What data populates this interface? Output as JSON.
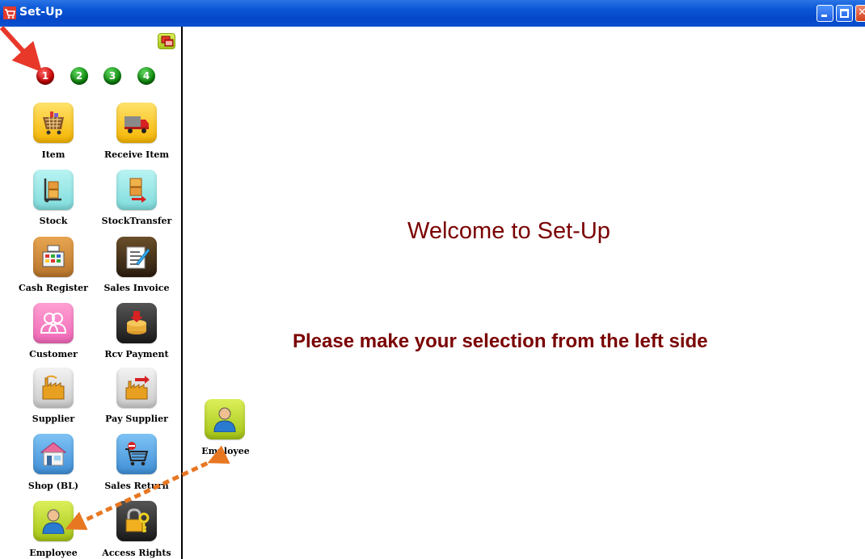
{
  "window": {
    "title": "Set-Up",
    "icon": "cart-icon",
    "controls": [
      "minimize-icon",
      "maximize-icon",
      "close-icon"
    ]
  },
  "sidebar": {
    "toggle_icon": "windows-icon",
    "pages": [
      {
        "label": "1",
        "state": "active",
        "color": "#c00000"
      },
      {
        "label": "2",
        "state": "inactive",
        "color": "#108a10"
      },
      {
        "label": "3",
        "state": "inactive",
        "color": "#108a10"
      },
      {
        "label": "4",
        "state": "inactive",
        "color": "#108a10"
      }
    ],
    "items": [
      {
        "label": "Item",
        "icon": "shopping-basket-icon"
      },
      {
        "label": "Receive Item",
        "icon": "truck-icon"
      },
      {
        "label": "Stock",
        "icon": "hand-truck-icon"
      },
      {
        "label": "StockTransfer",
        "icon": "stock-transfer-icon"
      },
      {
        "label": "Cash Register",
        "icon": "cash-register-icon"
      },
      {
        "label": "Sales Invoice",
        "icon": "invoice-icon"
      },
      {
        "label": "Customer",
        "icon": "customer-icon"
      },
      {
        "label": "Rcv Payment",
        "icon": "coins-icon"
      },
      {
        "label": "Supplier",
        "icon": "factory-icon"
      },
      {
        "label": "Pay Supplier",
        "icon": "factory-payment-icon"
      },
      {
        "label": "Shop (BL)",
        "icon": "shop-icon"
      },
      {
        "label": "Sales Return",
        "icon": "return-cart-icon"
      },
      {
        "label": "Employee",
        "icon": "employee-icon"
      },
      {
        "label": "Access Rights",
        "icon": "lock-key-icon"
      }
    ]
  },
  "main": {
    "welcome": "Welcome to Set-Up",
    "instruction": "Please make your selection from the left side"
  },
  "annotation": {
    "callout_label": "Employee",
    "callout_icon": "employee-icon",
    "arrow_color": "#e8382a",
    "dashed_arrow_color": "#e87722"
  }
}
